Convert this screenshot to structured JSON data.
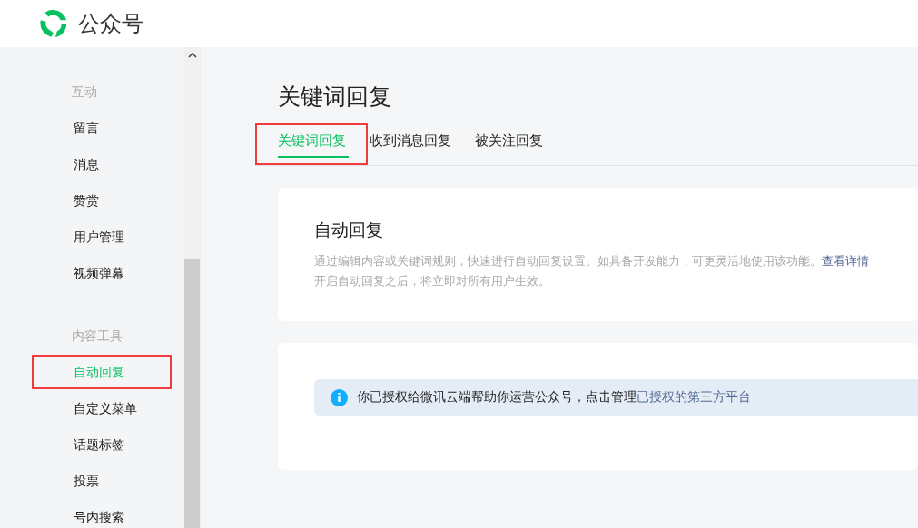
{
  "header": {
    "brand": "公众号"
  },
  "sidebar": {
    "groups": [
      {
        "title": "互动",
        "items": [
          {
            "label": "留言",
            "selected": false,
            "highlighted": false
          },
          {
            "label": "消息",
            "selected": false,
            "highlighted": false
          },
          {
            "label": "赞赏",
            "selected": false,
            "highlighted": false
          },
          {
            "label": "用户管理",
            "selected": false,
            "highlighted": false
          },
          {
            "label": "视频弹幕",
            "selected": false,
            "highlighted": false
          }
        ]
      },
      {
        "title": "内容工具",
        "items": [
          {
            "label": "自动回复",
            "selected": true,
            "highlighted": true
          },
          {
            "label": "自定义菜单",
            "selected": false,
            "highlighted": false
          },
          {
            "label": "话题标签",
            "selected": false,
            "highlighted": false
          },
          {
            "label": "投票",
            "selected": false,
            "highlighted": false
          },
          {
            "label": "号内搜索",
            "selected": false,
            "highlighted": false
          }
        ]
      }
    ]
  },
  "page_title": "关键词回复",
  "tabs": [
    {
      "label": "关键词回复",
      "selected": true,
      "highlighted": true
    },
    {
      "label": "收到消息回复",
      "selected": false,
      "highlighted": false
    },
    {
      "label": "被关注回复",
      "selected": false,
      "highlighted": false
    }
  ],
  "intro_card": {
    "title": "自动回复",
    "description": "通过编辑内容或关键词规则，快速进行自动回复设置。如具备开发能力，可更灵活地使用该功能。",
    "link": "查看详情",
    "note": "开启自动回复之后，将立即对所有用户生效。"
  },
  "notice": {
    "icon": "i",
    "text": "你已授权给微讯云端帮助你运营公众号，点击管理",
    "link": "已授权的第三方平台"
  }
}
